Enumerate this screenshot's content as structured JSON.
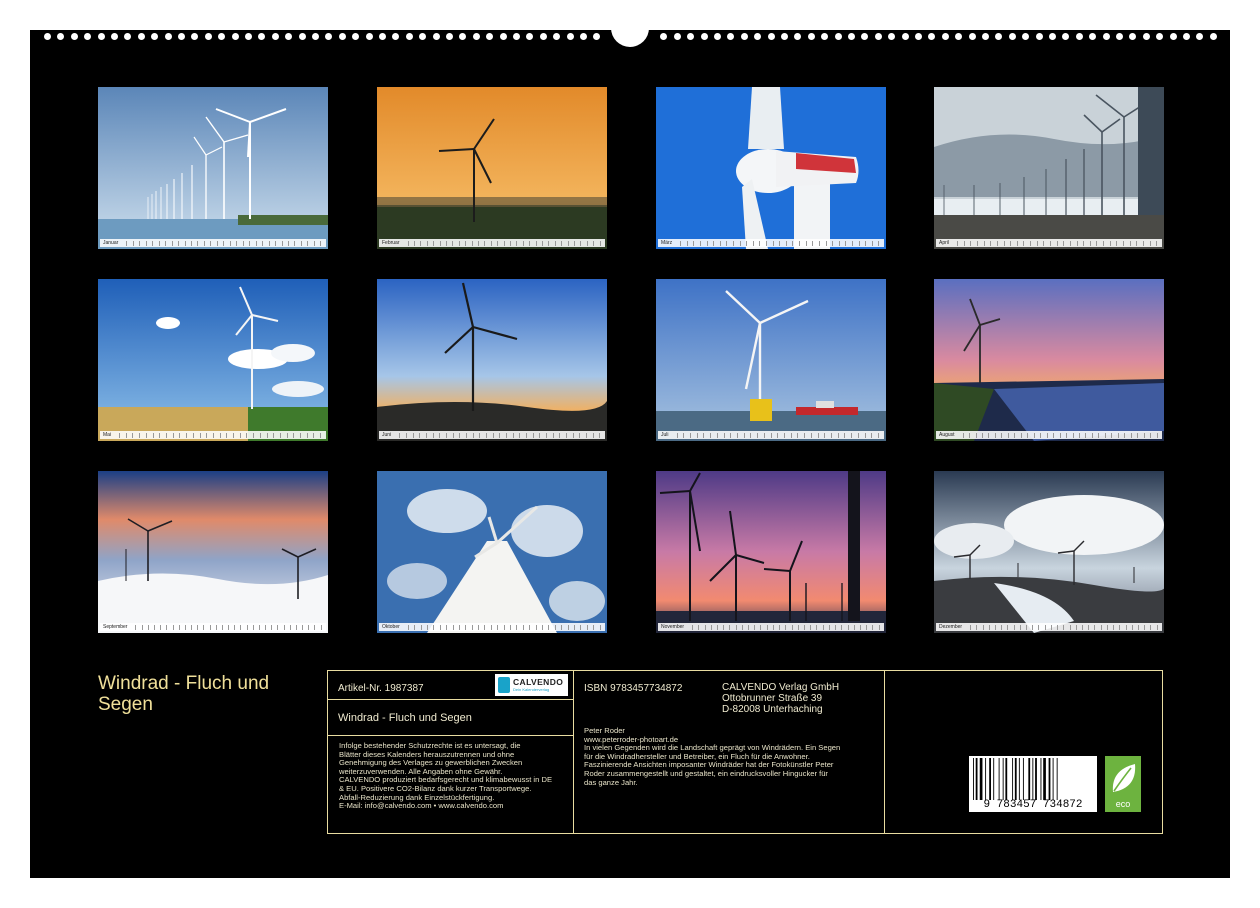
{
  "calendar": {
    "title": "Windrad - Fluch und Segen",
    "months": [
      {
        "label": "Januar"
      },
      {
        "label": "Februar"
      },
      {
        "label": "März"
      },
      {
        "label": "April"
      },
      {
        "label": "Mai"
      },
      {
        "label": "Juni"
      },
      {
        "label": "Juli"
      },
      {
        "label": "August"
      },
      {
        "label": "September"
      },
      {
        "label": "Oktober"
      },
      {
        "label": "November"
      },
      {
        "label": "Dezember"
      }
    ]
  },
  "info": {
    "article": "Artikel-Nr. 1987387",
    "product_title": "Windrad - Fluch und Segen",
    "isbn": "ISBN 9783457734872",
    "publisher": [
      "CALVENDO Verlag GmbH",
      "Ottobrunner Straße 39",
      "D-82008 Unterhaching"
    ],
    "legal": [
      "Infolge bestehender Schutzrechte ist es untersagt, die",
      "Blätter dieses Kalenders herauszutrennen und ohne",
      "Genehmigung des Verlages zu gewerblichen Zwecken",
      "weiterzuverwenden. Alle Angaben ohne Gewähr.",
      "CALVENDO produziert bedarfsgerecht und klimabewusst in DE",
      "& EU. Positivere CO2-Bilanz dank kurzer Transportwege.",
      "Abfall-Reduzierung dank Einzelstückfertigung.",
      "E-Mail: info@calvendo.com • www.calvendo.com"
    ],
    "author": "Peter Roder",
    "website": "www.peterroder-photoart.de",
    "description": [
      "In vielen Gegenden wird die Landschaft geprägt von Windrädern. Ein Segen",
      "für die Windradhersteller und Betreiber, ein Fluch für die Anwohner.",
      "Faszinierende Ansichten imposanter Windräder hat der Fotokünstler Peter",
      "Roder zusammengestellt und gestaltet, ein eindrucksvoller Hingucker für",
      "das ganze Jahr."
    ],
    "barcode_number": "9 783457 734872",
    "logo": {
      "name": "CALVENDO",
      "tagline": "Dein Kalenderverlag",
      "icon": "calvendo-logo-icon"
    },
    "eco": {
      "label": "eco",
      "icon": "leaf-icon",
      "color": "#6db33f"
    }
  },
  "colors": {
    "background": "#000000",
    "title": "#f0e09a",
    "border": "#e8dca0",
    "brand": "#19a3c9"
  }
}
